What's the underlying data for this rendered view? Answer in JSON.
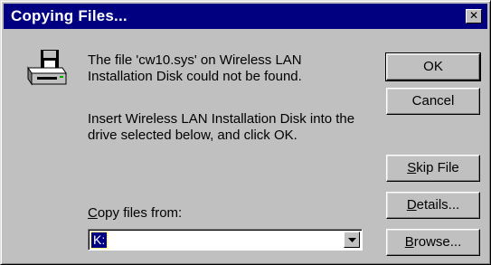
{
  "window": {
    "title": "Copying Files...",
    "close_glyph": "✕"
  },
  "message": {
    "line1": "The file 'cw10.sys' on Wireless LAN Installation Disk could not be found.",
    "line2": "Insert Wireless LAN Installation Disk into the drive selected below, and click OK."
  },
  "copy_from": {
    "label_prefix": "",
    "label_mnemonic": "C",
    "label_rest": "opy files from:",
    "value": "K:"
  },
  "buttons": {
    "ok": "OK",
    "cancel": "Cancel",
    "skip_mnemonic": "S",
    "skip_rest": "kip File",
    "details_mnemonic": "D",
    "details_rest": "etails...",
    "browse_mnemonic": "B",
    "browse_rest": "rowse..."
  },
  "icons": {
    "dialog_icon": "disk-drive-icon",
    "dropdown_icon": "chevron-down-icon"
  },
  "colors": {
    "titlebar": "#000080",
    "face": "#c0c0c0",
    "selection": "#000080"
  }
}
